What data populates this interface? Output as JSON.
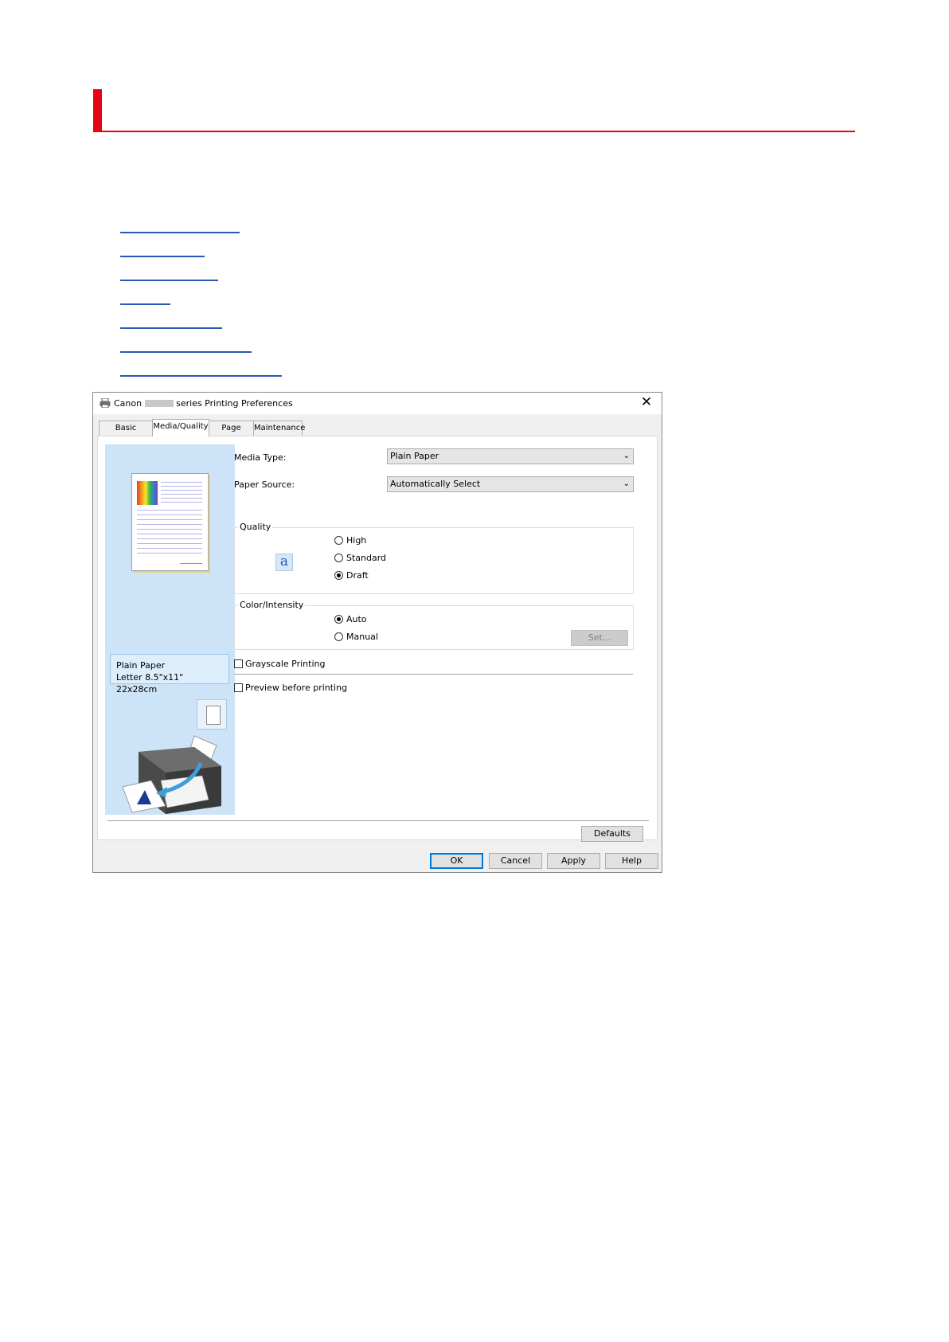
{
  "page": {
    "accent_color": "#e30613",
    "link_color": "#2a58b8",
    "link_placeholders": 7
  },
  "dialog": {
    "title_prefix": "Canon",
    "title_suffix": "series Printing Preferences",
    "close_glyph": "✕",
    "tabs": [
      {
        "label": "Basic Settings",
        "active": false
      },
      {
        "label": "Media/Quality",
        "active": true
      },
      {
        "label": "Page Setup",
        "active": false
      },
      {
        "label": "Maintenance",
        "active": false
      }
    ],
    "preview": {
      "paper_type": "Plain Paper",
      "paper_size": "Letter 8.5\"x11\" 22x28cm"
    },
    "media_type": {
      "label": "Media Type:",
      "value": "Plain Paper"
    },
    "paper_source": {
      "label": "Paper Source:",
      "value": "Automatically Select"
    },
    "quality": {
      "title": "Quality",
      "options": [
        {
          "label": "High",
          "selected": false
        },
        {
          "label": "Standard",
          "selected": false
        },
        {
          "label": "Draft",
          "selected": true
        }
      ]
    },
    "color_intensity": {
      "title": "Color/Intensity",
      "options": [
        {
          "label": "Auto",
          "selected": true
        },
        {
          "label": "Manual",
          "selected": false
        }
      ],
      "set_button": "Set..."
    },
    "grayscale": {
      "label": "Grayscale Printing",
      "checked": false
    },
    "preview_before_printing": {
      "label": "Preview before printing",
      "checked": false
    },
    "defaults_button": "Defaults",
    "buttons": {
      "ok": "OK",
      "cancel": "Cancel",
      "apply": "Apply",
      "help": "Help"
    }
  }
}
